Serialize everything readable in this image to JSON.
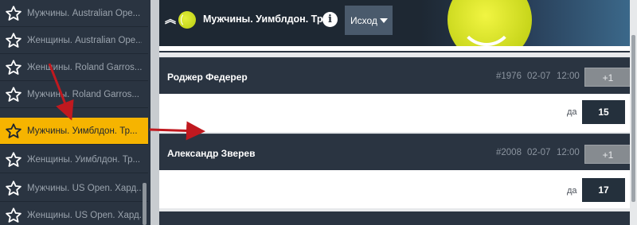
{
  "sidebar": {
    "items": [
      {
        "label": "Мужчины. Australian Ope..."
      },
      {
        "label": "Женщины. Australian Ope..."
      },
      {
        "label": "Женщины. Roland Garros..."
      },
      {
        "label": "Мужчины. Roland Garros..."
      },
      {
        "label": "Мужчины. Уимблдон. Тр..."
      },
      {
        "label": "Женщины. Уимблдон. Тр..."
      },
      {
        "label": "Мужчины. US Open. Хард..."
      },
      {
        "label": "Женщины. US Open. Хард..."
      }
    ],
    "active_index": 4
  },
  "header": {
    "title": "Мужчины. Уимблдон. Тра...",
    "info_icon": "i",
    "select_label": "Исход"
  },
  "events": [
    {
      "player": "Роджер Федерер",
      "id": "#1976",
      "date": "02-07",
      "time": "12:00",
      "plus": "+1",
      "option_label": "да",
      "odds": "15"
    },
    {
      "player": "Александр Зверев",
      "id": "#2008",
      "date": "02-07",
      "time": "12:00",
      "plus": "+1",
      "option_label": "да",
      "odds": "17"
    }
  ],
  "colors": {
    "accent": "#f6b400",
    "sidebar_bg": "#2a3441",
    "arrow": "#c0191f"
  }
}
